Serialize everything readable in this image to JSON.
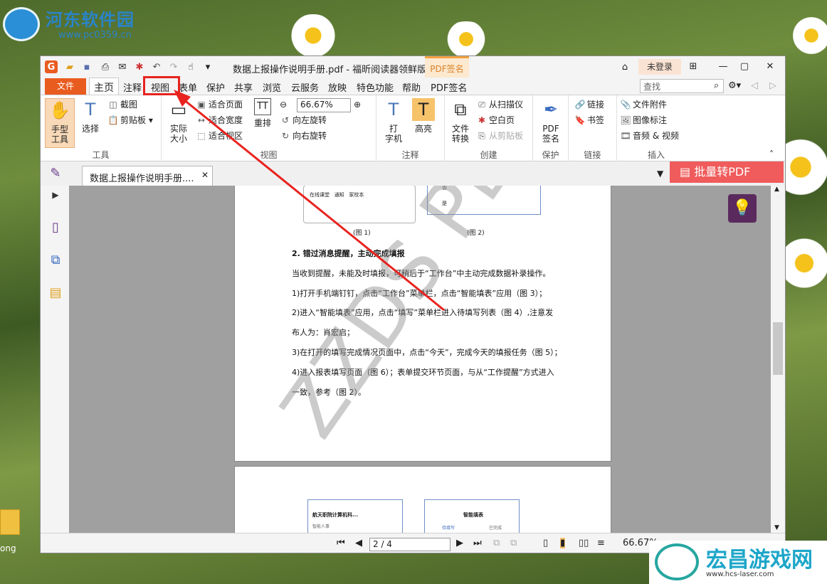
{
  "watermark_site": {
    "name": "河东软件园",
    "url": "www.pc0359.cn"
  },
  "desktop": {
    "icon_label": "ong"
  },
  "titlebar": {
    "title": "数据上报操作说明手册.pdf - 福昕阅读器领鲜版",
    "pdf_sign_tab": "PDF签名",
    "login": "未登录"
  },
  "menu": {
    "file": "文件",
    "tabs": [
      "主页",
      "注释",
      "视图",
      "表单",
      "保护",
      "共享",
      "浏览",
      "云服务",
      "放映",
      "特色功能",
      "帮助",
      "PDF签名"
    ],
    "search_placeholder": "查找"
  },
  "ribbon": {
    "tools": {
      "hand": "手型\n工具",
      "select": "选择",
      "screenshot": "截图",
      "clipboard": "剪贴板",
      "label": "工具"
    },
    "view": {
      "actual_size": "实际\n大小",
      "fit_page": "适合页面",
      "fit_width": "适合宽度",
      "fit_visible": "适合视区",
      "reflow": "重排",
      "zoom": "66.67%",
      "rotate_left": "向左旋转",
      "rotate_right": "向右旋转",
      "label": "视图"
    },
    "comment": {
      "typewriter": "打\n字机",
      "highlight": "高亮",
      "label": "注释"
    },
    "create": {
      "convert": "文件\n转换",
      "from_scanner": "从扫描仪",
      "blank_page": "空白页",
      "from_clipboard": "从剪贴板",
      "label": "创建"
    },
    "protect": {
      "pdf_sign": "PDF\n签名",
      "label": "保护"
    },
    "links": {
      "link": "链接",
      "bookmark": "书签",
      "label": "链接"
    },
    "insert": {
      "attachment": "文件附件",
      "image_annotation": "图像标注",
      "audio_video": "音频 & 视频",
      "label": "插入"
    }
  },
  "doc_tab": {
    "name": "数据上报操作说明手册....",
    "batch": "批量转PDF"
  },
  "document": {
    "fig1_items": [
      "在线课堂",
      "通知",
      "家校本"
    ],
    "fig2_items": [
      "否",
      "是"
    ],
    "fig1_caption": "(图 1)",
    "fig2_caption": "(图 2)",
    "heading": "2. 错过消息提醒，主动完成填报",
    "paragraphs": [
      "当收到提醒，未能及时填报，可稍后于“工作台”中主动完成数据补录操作。",
      "1)打开手机端钉钉，点击“工作台”菜单栏，点击“智能填表”应用（图 3）；",
      "2)进入“智能填表”应用，点击“填写”菜单栏进入待填写列表（图 4）,注意发",
      "布人为：肖宏启；",
      "3)在打开的填写完成情况页面中，点击“今天”，完成今天的填报任务（图 5）；",
      "4)进入报表填写页面（图 6）；表单提交环节页面，与从“工作提醒”方式进入",
      "一致，参考（图 2）。"
    ],
    "watermark": "ZZDS PDF",
    "page2_mock1_title": "航天职院计算机科...",
    "page2_mock1_sub": "智能人事",
    "page2_mock2_title": "智能填表",
    "page2_mock2_tabs": [
      "待填写",
      "已完成"
    ]
  },
  "statusbar": {
    "page": "2 / 4",
    "zoom": "66.67%"
  },
  "brand": {
    "name": "宏昌游戏网",
    "url": "www.hcs-laser.com"
  },
  "colors": {
    "accent": "#e95c20",
    "annotation": "#e8231f"
  }
}
